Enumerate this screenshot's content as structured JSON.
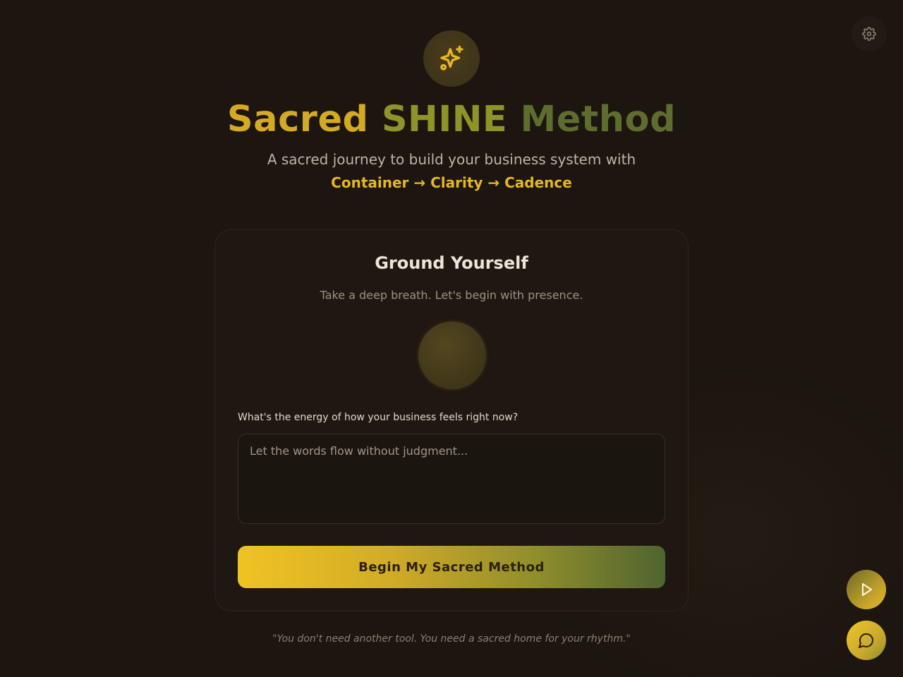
{
  "header": {
    "icon": "sparkles-icon",
    "title_part1": "Sacred",
    "title_part2": "SHINE",
    "title_part3": "Method",
    "subtitle": "A sacred journey to build your business system with",
    "flow": "Container → Clarity → Cadence"
  },
  "card": {
    "title": "Ground Yourself",
    "subtitle": "Take a deep breath. Let's begin with presence.",
    "question_label": "What's the energy of how your business feels right now?",
    "input_value": "",
    "input_placeholder": "Let the words flow without judgment...",
    "button_label": "Begin My Sacred Method"
  },
  "footer": {
    "quote": "\"You don't need another tool. You need a sacred home for your rhythm.\""
  },
  "controls": {
    "settings_icon": "gear-icon",
    "play_icon": "play-icon",
    "chat_icon": "chat-bubble-icon"
  },
  "colors": {
    "background": "#1c1510",
    "accent_gold": "#e6b820",
    "accent_olive": "#5e6c2e"
  }
}
